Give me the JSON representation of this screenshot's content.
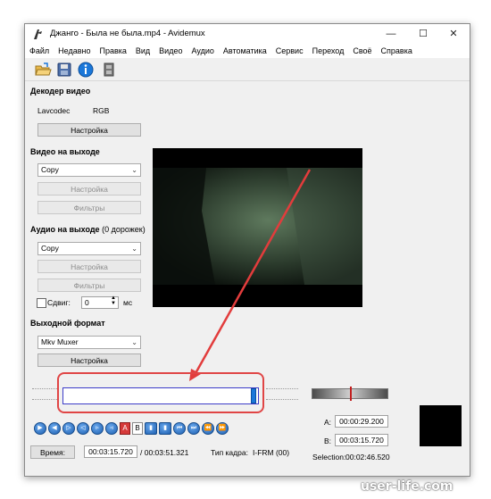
{
  "window": {
    "title": "Джанго - Была не была.mp4 - Avidemux",
    "controls": {
      "minimize": "—",
      "maximize": "☐",
      "close": "✕"
    }
  },
  "menu": [
    "Файл",
    "Недавно",
    "Правка",
    "Вид",
    "Видео",
    "Аудио",
    "Автоматика",
    "Сервис",
    "Переход",
    "Своё",
    "Справка"
  ],
  "toolbar_icons": [
    "open-folder-icon",
    "save-disk-icon",
    "info-icon",
    "film-icon"
  ],
  "decoder": {
    "heading": "Декодер видео",
    "codec": "Lavcodec",
    "format": "RGB",
    "settings_button": "Настройка"
  },
  "video_output": {
    "heading": "Видео на выходе",
    "codec_selected": "Copy",
    "settings_button": "Настройка",
    "filters_button": "Фильтры"
  },
  "audio_output": {
    "heading": "Аудио на выходе",
    "tracks_note": "(0 дорожек)",
    "codec_selected": "Copy",
    "settings_button": "Настройка",
    "filters_button": "Фильтры",
    "shift_label": "Сдвиг:",
    "shift_value": "0",
    "shift_unit": "мс"
  },
  "output_format": {
    "heading": "Выходной формат",
    "muxer_selected": "Mkv Muxer",
    "settings_button": "Настройка"
  },
  "timeline": {
    "position_fraction": 0.97
  },
  "playback_buttons": [
    "play",
    "rewind",
    "forward",
    "prev-frame",
    "next-frame",
    "prev-keyframe",
    "next-keyframe"
  ],
  "markers": {
    "a_label": "A",
    "b_label": "B"
  },
  "status": {
    "time_button": "Время:",
    "current_time": "00:03:15.720",
    "total_time": "/ 00:03:51.321",
    "frame_type_label": "Тип кадра:",
    "frame_type": "I-FRM (00)"
  },
  "selection": {
    "a_label": "A:",
    "a_time": "00:00:29.200",
    "b_label": "B:",
    "b_time": "00:03:15.720",
    "selection_label": "Selection:",
    "selection_time": "00:02:46.520"
  },
  "watermark": "user-life.com",
  "colors": {
    "accent": "#1a77d9",
    "highlight": "#e04545",
    "marker": "#c21f1f"
  }
}
